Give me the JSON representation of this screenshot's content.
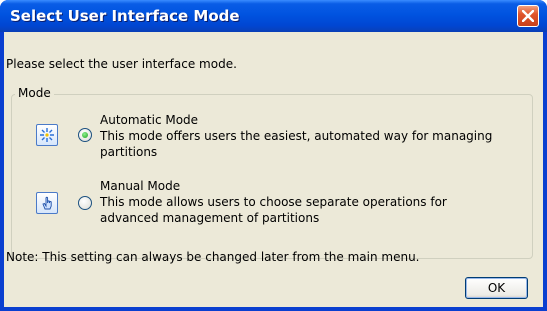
{
  "window": {
    "title": "Select User Interface Mode"
  },
  "dialog": {
    "prompt": "Please select the user interface mode.",
    "group_label": "Mode",
    "options": [
      {
        "label": "Automatic Mode",
        "description_line1": "This mode offers users the easiest, automated way for managing",
        "description_line2": "partitions",
        "selected": true,
        "icon": "magic-wand-icon"
      },
      {
        "label": "Manual Mode",
        "description_line1": "This mode allows users to choose separate operations for",
        "description_line2": "advanced management of partitions",
        "selected": false,
        "icon": "hand-pointer-icon"
      }
    ],
    "note": "Note: This setting can always be changed later from the main menu.",
    "ok_label": "OK"
  },
  "colors": {
    "title_bar": "#0053e0",
    "close_button": "#e0552c",
    "dialog_bg": "#ece9d8",
    "radio_selected": "#21a121"
  }
}
